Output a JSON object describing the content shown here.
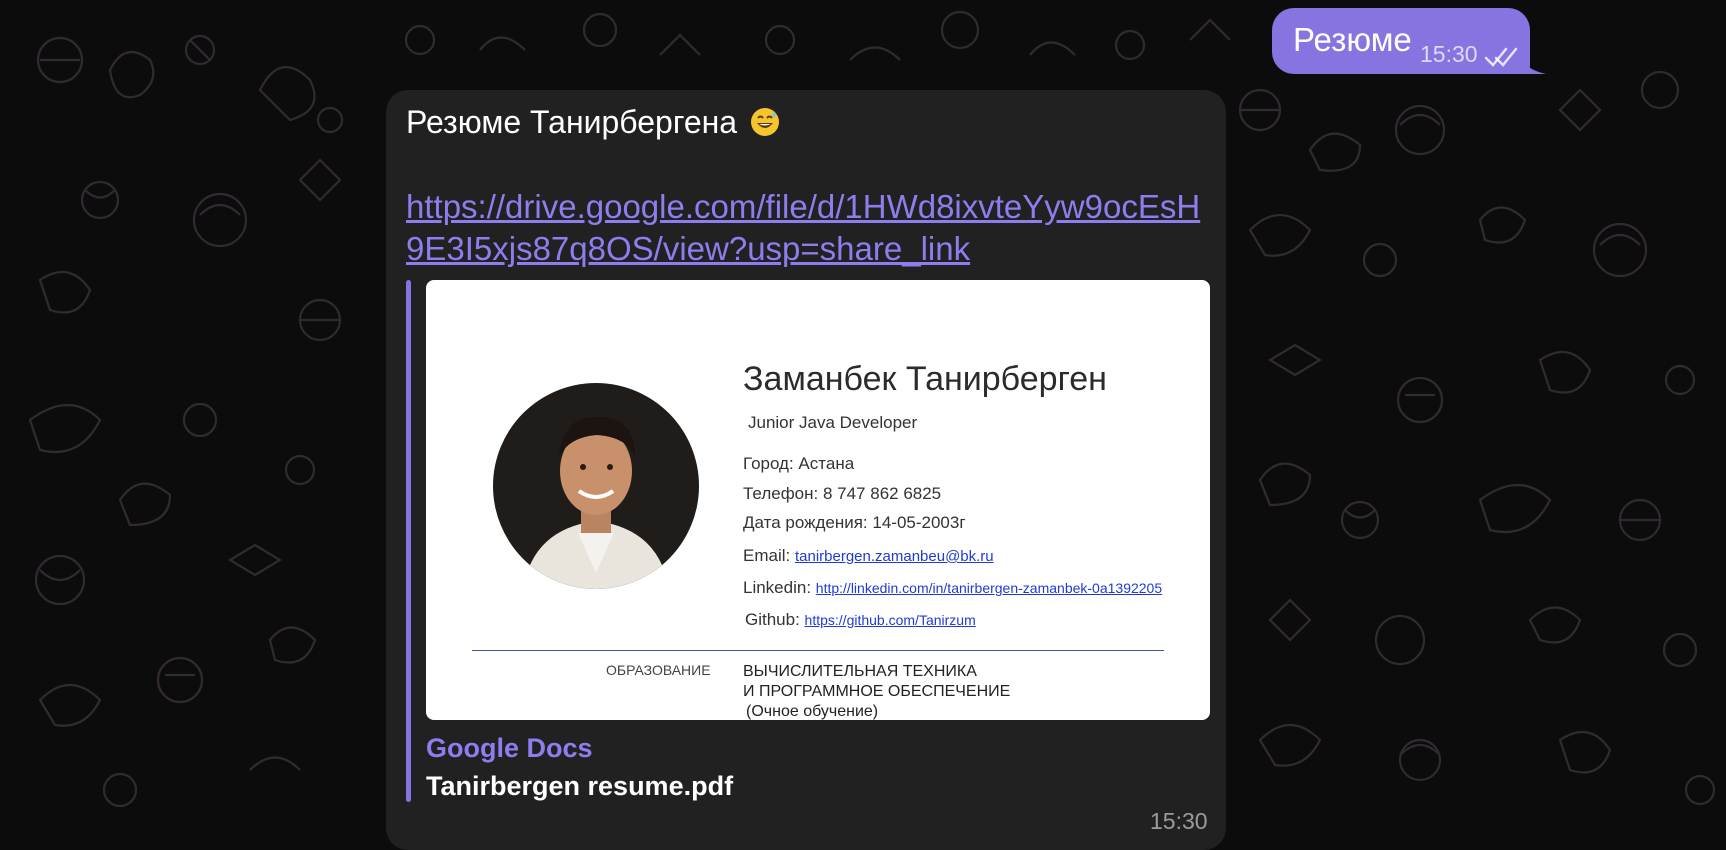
{
  "outgoing": {
    "text": "Резюме",
    "time": "15:30",
    "status_icon": "double-check-icon",
    "bubble_color": "#8774e1"
  },
  "incoming": {
    "text": "Резюме Танирбергена",
    "emoji": "sweat-smile-emoji",
    "link": "https://drive.google.com/file/d/1HWd8ixvteYyw9ocEsH9E3I5xjs87q8OS/view?usp=share_link",
    "time": "15:30",
    "bubble_color": "#212121"
  },
  "preview": {
    "site_name": "Google Docs",
    "title": "Tanirbergen resume.pdf",
    "accent": "#8774e1",
    "cv": {
      "name": "Заманбек Танирберген",
      "role": "Junior Java Developer",
      "city": "Город: Астана",
      "phone": "Телефон: 8 747 862 6825",
      "birth": "Дата рождения: 14-05-2003г",
      "email_label": "Email:",
      "email": "tanirbergen.zamanbeu@bk.ru",
      "linkedin_label": "Linkedin:",
      "linkedin": "http://linkedin.com/in/tanirbergen-zamanbek-0a1392205",
      "github_label": "Github:",
      "github": "https://github.com/Tanirzum",
      "section": "ОБРАЗОВАНИЕ",
      "edu_line1": "ВЫЧИСЛИТЕЛЬНАЯ ТЕХНИКА",
      "edu_line2": "И ПРОГРАММНОЕ ОБЕСПЕЧЕНИЕ",
      "edu_line3": "(Очное обучение)"
    }
  }
}
